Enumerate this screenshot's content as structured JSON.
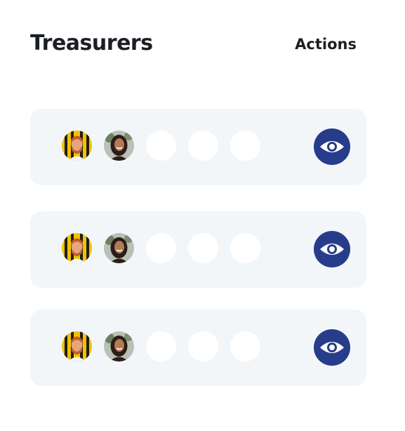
{
  "header": {
    "title": "Treasurers",
    "actions_label": "Actions"
  },
  "rows": [
    {
      "avatars": [
        "avatar-man-beard",
        "avatar-woman-curly-hair"
      ],
      "empty_slots": 3,
      "action_icon": "eye-icon"
    },
    {
      "avatars": [
        "avatar-man-beard",
        "avatar-woman-curly-hair"
      ],
      "empty_slots": 3,
      "action_icon": "eye-icon"
    },
    {
      "avatars": [
        "avatar-man-beard",
        "avatar-woman-curly-hair"
      ],
      "empty_slots": 3,
      "action_icon": "eye-icon"
    }
  ],
  "colors": {
    "row_background": "#f3f6f9",
    "action_button": "#273c8a",
    "text": "#1b1f24"
  }
}
